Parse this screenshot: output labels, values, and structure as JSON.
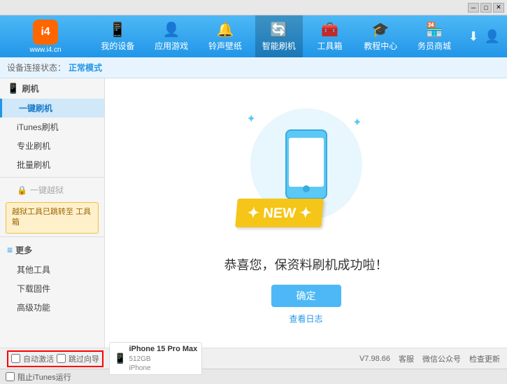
{
  "titlebar": {
    "controls": [
      "minimize",
      "maximize",
      "close"
    ]
  },
  "header": {
    "logo": {
      "icon": "i4",
      "text": "www.i4.cn"
    },
    "nav_items": [
      {
        "id": "my-device",
        "icon": "📱",
        "label": "我的设备"
      },
      {
        "id": "apps-games",
        "icon": "👤",
        "label": "应用游戏"
      },
      {
        "id": "ringtones",
        "icon": "🔔",
        "label": "铃声壁纸"
      },
      {
        "id": "smart-flash",
        "icon": "🔄",
        "label": "智能刷机",
        "active": true
      },
      {
        "id": "toolbox",
        "icon": "🧰",
        "label": "工具箱"
      },
      {
        "id": "tutorial",
        "icon": "🎓",
        "label": "教程中心"
      },
      {
        "id": "service",
        "icon": "🏪",
        "label": "务员商城"
      }
    ],
    "right_actions": [
      {
        "id": "download",
        "icon": "⬇"
      },
      {
        "id": "user",
        "icon": "👤"
      }
    ]
  },
  "status_bar": {
    "prefix": "设备连接状态：",
    "status": "正常模式"
  },
  "sidebar": {
    "sections": [
      {
        "id": "flash-section",
        "icon": "📱",
        "label": "刷机",
        "items": [
          {
            "id": "one-key-flash",
            "label": "一键刷机",
            "active": true
          },
          {
            "id": "itunes-flash",
            "label": "iTunes刷机"
          },
          {
            "id": "pro-flash",
            "label": "专业刷机"
          },
          {
            "id": "batch-flash",
            "label": "批量刷机"
          }
        ]
      },
      {
        "id": "one-key-jailbreak",
        "disabled": true,
        "icon": "🔒",
        "label": "一键越狱",
        "warning": "越狱工具已跳转至\n工具箱"
      },
      {
        "id": "more-section",
        "icon": "≡",
        "label": "更多",
        "items": [
          {
            "id": "other-tools",
            "label": "其他工具"
          },
          {
            "id": "download-firmware",
            "label": "下载固件"
          },
          {
            "id": "advanced",
            "label": "高级功能"
          }
        ]
      }
    ]
  },
  "content": {
    "success_title": "恭喜您，保资料刷机成功啦！",
    "confirm_button": "确定",
    "view_log": "查看日志",
    "badge_text": "✦ NEW ✦"
  },
  "bottom_bar": {
    "auto_activate_label": "自动激活",
    "guide_label": "跳过向导",
    "device": {
      "name": "iPhone 15 Pro Max",
      "storage": "512GB",
      "type": "iPhone"
    },
    "version": "V7.98.66",
    "links": [
      {
        "id": "desktop",
        "label": "客服"
      },
      {
        "id": "wechat",
        "label": "微信公众号"
      },
      {
        "id": "check-update",
        "label": "检查更新"
      }
    ]
  },
  "footer": {
    "itunes_label": "阻止iTunes运行"
  }
}
